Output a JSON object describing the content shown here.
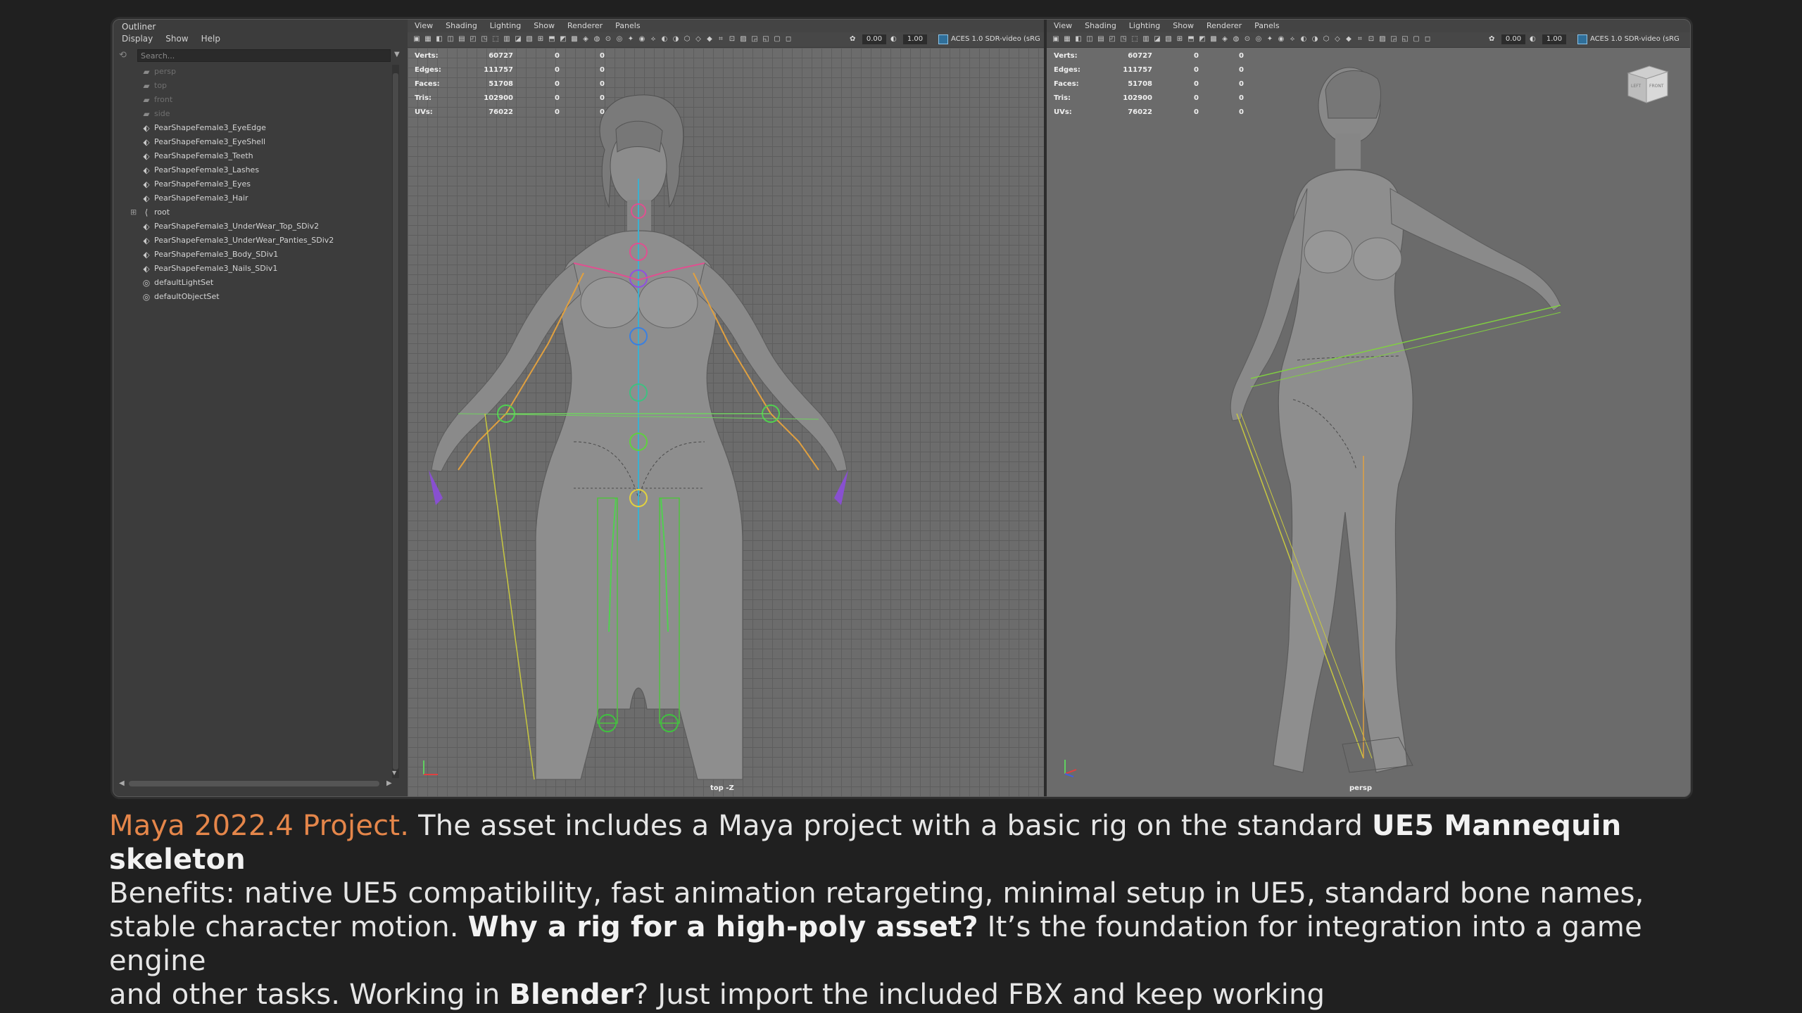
{
  "outliner": {
    "title": "Outliner",
    "menu": [
      "Display",
      "Show",
      "Help"
    ],
    "search_placeholder": "Search...",
    "items": [
      {
        "label": "persp",
        "icon": "camera-icon",
        "dim": true
      },
      {
        "label": "top",
        "icon": "camera-icon",
        "dim": true
      },
      {
        "label": "front",
        "icon": "camera-icon",
        "dim": true
      },
      {
        "label": "side",
        "icon": "camera-icon",
        "dim": true
      },
      {
        "label": "PearShapeFemale3_EyeEdge",
        "icon": "mesh-icon",
        "dim": false
      },
      {
        "label": "PearShapeFemale3_EyeShell",
        "icon": "mesh-icon",
        "dim": false
      },
      {
        "label": "PearShapeFemale3_Teeth",
        "icon": "mesh-icon",
        "dim": false
      },
      {
        "label": "PearShapeFemale3_Lashes",
        "icon": "mesh-icon",
        "dim": false
      },
      {
        "label": "PearShapeFemale3_Eyes",
        "icon": "mesh-icon",
        "dim": false
      },
      {
        "label": "PearShapeFemale3_Hair",
        "icon": "mesh-icon",
        "dim": false
      },
      {
        "label": "root",
        "icon": "joint-icon",
        "dim": false,
        "expand": true
      },
      {
        "label": "PearShapeFemale3_UnderWear_Top_SDiv2",
        "icon": "mesh-icon",
        "dim": false
      },
      {
        "label": "PearShapeFemale3_UnderWear_Panties_SDiv2",
        "icon": "mesh-icon",
        "dim": false
      },
      {
        "label": "PearShapeFemale3_Body_SDiv1",
        "icon": "mesh-icon",
        "dim": false
      },
      {
        "label": "PearShapeFemale3_Nails_SDiv1",
        "icon": "mesh-icon",
        "dim": false
      },
      {
        "label": "defaultLightSet",
        "icon": "set-icon",
        "dim": false
      },
      {
        "label": "defaultObjectSet",
        "icon": "set-icon",
        "dim": false
      }
    ]
  },
  "viewports": [
    {
      "id": "front",
      "menu": [
        "View",
        "Shading",
        "Lighting",
        "Show",
        "Renderer",
        "Panels"
      ],
      "exposure": "0.00",
      "gamma": "1.00",
      "color_management": "ACES 1.0 SDR-video (sRG",
      "hud": [
        {
          "label": "Verts:",
          "v1": "60727",
          "v2": "0",
          "v3": "0"
        },
        {
          "label": "Edges:",
          "v1": "111757",
          "v2": "0",
          "v3": "0"
        },
        {
          "label": "Faces:",
          "v1": "51708",
          "v2": "0",
          "v3": "0"
        },
        {
          "label": "Tris:",
          "v1": "102900",
          "v2": "0",
          "v3": "0"
        },
        {
          "label": "UVs:",
          "v1": "76022",
          "v2": "0",
          "v3": "0"
        }
      ],
      "camera_label": "top -Z"
    },
    {
      "id": "persp",
      "menu": [
        "View",
        "Shading",
        "Lighting",
        "Show",
        "Renderer",
        "Panels"
      ],
      "exposure": "0.00",
      "gamma": "1.00",
      "color_management": "ACES 1.0 SDR-video (sRG",
      "hud": [
        {
          "label": "Verts:",
          "v1": "60727",
          "v2": "0",
          "v3": "0"
        },
        {
          "label": "Edges:",
          "v1": "111757",
          "v2": "0",
          "v3": "0"
        },
        {
          "label": "Faces:",
          "v1": "51708",
          "v2": "0",
          "v3": "0"
        },
        {
          "label": "Tris:",
          "v1": "102900",
          "v2": "0",
          "v3": "0"
        },
        {
          "label": "UVs:",
          "v1": "76022",
          "v2": "0",
          "v3": "0"
        }
      ],
      "camera_label": "persp",
      "viewcube": {
        "left": "LEFT",
        "front": "FRONT"
      }
    }
  ],
  "caption": {
    "accent_color": "#e5864a",
    "segments": [
      {
        "text": "Maya 2022.4 Project.",
        "style": "accent"
      },
      {
        "text": " The asset includes a Maya project with a basic rig on the standard ",
        "style": "normal"
      },
      {
        "text": "UE5 Mannequin skeleton",
        "style": "bold"
      },
      {
        "text": "\nBenefits: native UE5 compatibility, fast animation retargeting, minimal setup in UE5, standard bone names,\nstable character motion. ",
        "style": "normal"
      },
      {
        "text": "Why a rig for a high-poly asset?",
        "style": "bold"
      },
      {
        "text": " It’s the foundation for integration into a game engine\nand other tasks. Working in ",
        "style": "normal"
      },
      {
        "text": "Blender",
        "style": "bold"
      },
      {
        "text": "? Just import the included FBX and keep working",
        "style": "normal"
      }
    ]
  }
}
